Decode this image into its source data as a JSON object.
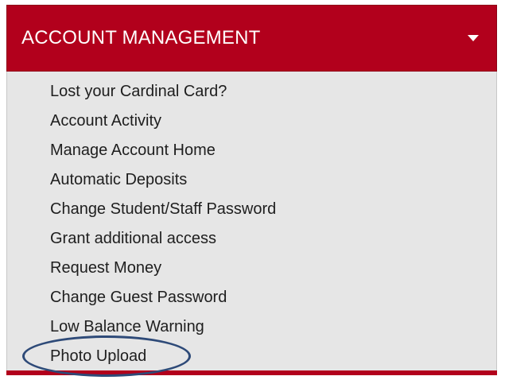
{
  "panel": {
    "title": "ACCOUNT MANAGEMENT",
    "toggle_icon": "caret-down-icon",
    "expanded": true,
    "colors": {
      "header_background": "#b2001c",
      "body_background": "#e6e6e6",
      "highlight_outline": "#2e4a78"
    }
  },
  "menu": {
    "items": [
      {
        "label": "Lost your Cardinal Card?"
      },
      {
        "label": "Account Activity"
      },
      {
        "label": "Manage Account Home"
      },
      {
        "label": "Automatic Deposits"
      },
      {
        "label": "Change Student/Staff Password"
      },
      {
        "label": "Grant additional access"
      },
      {
        "label": "Request Money"
      },
      {
        "label": "Change Guest Password"
      },
      {
        "label": "Low Balance Warning"
      },
      {
        "label": "Photo Upload",
        "highlighted": true
      }
    ]
  }
}
